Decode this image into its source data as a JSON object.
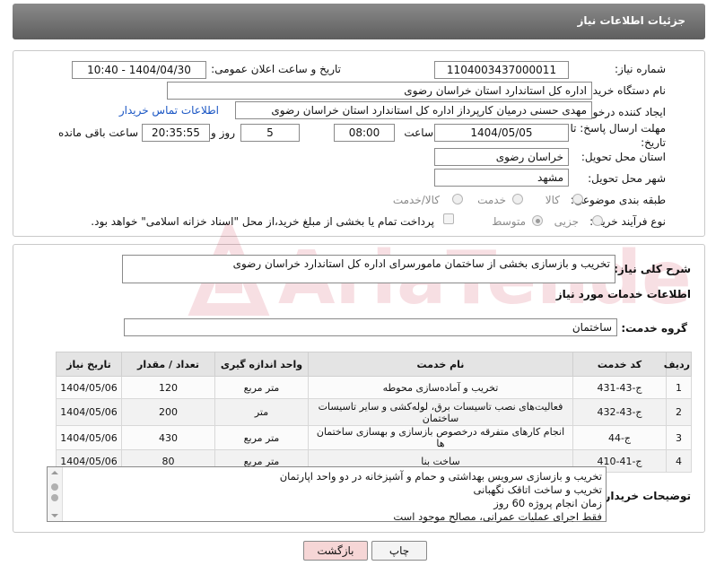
{
  "header": {
    "title": "جزئیات اطلاعات نیاز"
  },
  "form": {
    "need_number_label": "شماره نیاز:",
    "need_number": "1104003437000011",
    "announce_label": "تاریخ و ساعت اعلان عمومی:",
    "announce_value": "1404/04/30 - 10:40",
    "buyer_org_label": "نام دستگاه خریدار:",
    "buyer_org": "اداره کل استاندارد استان خراسان رضوی",
    "creator_label": "ایجاد کننده درخواست:",
    "creator": "مهدی حسنی درمیان کارپرداز اداره کل استاندارد استان خراسان رضوی",
    "contact_link": "اطلاعات تماس خریدار",
    "deadline_label_1": "مهلت ارسال پاسخ: تا",
    "deadline_label_2": "تاریخ:",
    "deadline_date": "1404/05/05",
    "time_label": "ساعت",
    "deadline_time": "08:00",
    "days_value": "5",
    "days_label": "روز و",
    "remaining_time": "20:35:55",
    "remaining_label": "ساعت باقی مانده",
    "province_label": "استان محل تحویل:",
    "province": "خراسان رضوی",
    "city_label": "شهر محل تحویل:",
    "city": "مشهد",
    "category_label": "طبقه بندی موضوعی:",
    "cat_goods": "کالا",
    "cat_service": "خدمت",
    "cat_goods_service": "کالا/خدمت",
    "process_label": "نوع فرآیند خرید :",
    "proc_partial": "جزیی",
    "proc_medium": "متوسط",
    "payment_note": "پرداخت تمام یا بخشی از مبلغ خرید،از محل \"اسناد خزانه اسلامی\" خواهد بود."
  },
  "description": {
    "label": "شرح کلی نیاز:",
    "text": "تخریب و بازسازی بخشی از ساختمان مامورسرای اداره کل استاندارد خراسان رضوی"
  },
  "services": {
    "section_title": "اطلاعات خدمات مورد نیاز",
    "group_label": "گروه خدمت:",
    "group_value": "ساختمان",
    "columns": [
      "ردیف",
      "کد خدمت",
      "نام خدمت",
      "واحد اندازه گیری",
      "تعداد / مقدار",
      "تاریخ نیاز"
    ],
    "rows": [
      {
        "row": "1",
        "code": "ج-43-431",
        "name": "تخریب و آماده‌سازی محوطه",
        "unit": "متر مربع",
        "qty": "120",
        "date": "1404/05/06"
      },
      {
        "row": "2",
        "code": "ج-43-432",
        "name": "فعالیت‌های نصب تاسیسات برق، لوله‌کشی و سایر تاسیسات ساختمان",
        "unit": "متر",
        "qty": "200",
        "date": "1404/05/06"
      },
      {
        "row": "3",
        "code": "ج-44",
        "name": "انجام کارهای متفرقه درخصوص بازسازی و بهسازی ساختمان ها",
        "unit": "متر مربع",
        "qty": "430",
        "date": "1404/05/06"
      },
      {
        "row": "4",
        "code": "ج-41-410",
        "name": "ساخت بنا",
        "unit": "متر مربع",
        "qty": "80",
        "date": "1404/05/06"
      }
    ]
  },
  "buyer_notes": {
    "label": "توضیحات خریدار:",
    "lines": [
      "تخریب و بازسازی سرویس بهداشتی و حمام و آشپزخانه در دو واحد اپارتمان",
      "تخریب و ساخت اتاقک نگهبانی",
      "زمان انجام پروژه 60 روز",
      "فقط اجرای عملیات عمرانی، مصالح موجود است"
    ]
  },
  "buttons": {
    "print": "چاپ",
    "back": "بازگشت"
  },
  "watermark": {
    "text": "AriaTender.neT"
  },
  "colors": {
    "header_bg": "#6f6f6f",
    "link": "#1a56c4",
    "back_button_bg": "#f6d6d6",
    "watermark": "#c8102e"
  }
}
